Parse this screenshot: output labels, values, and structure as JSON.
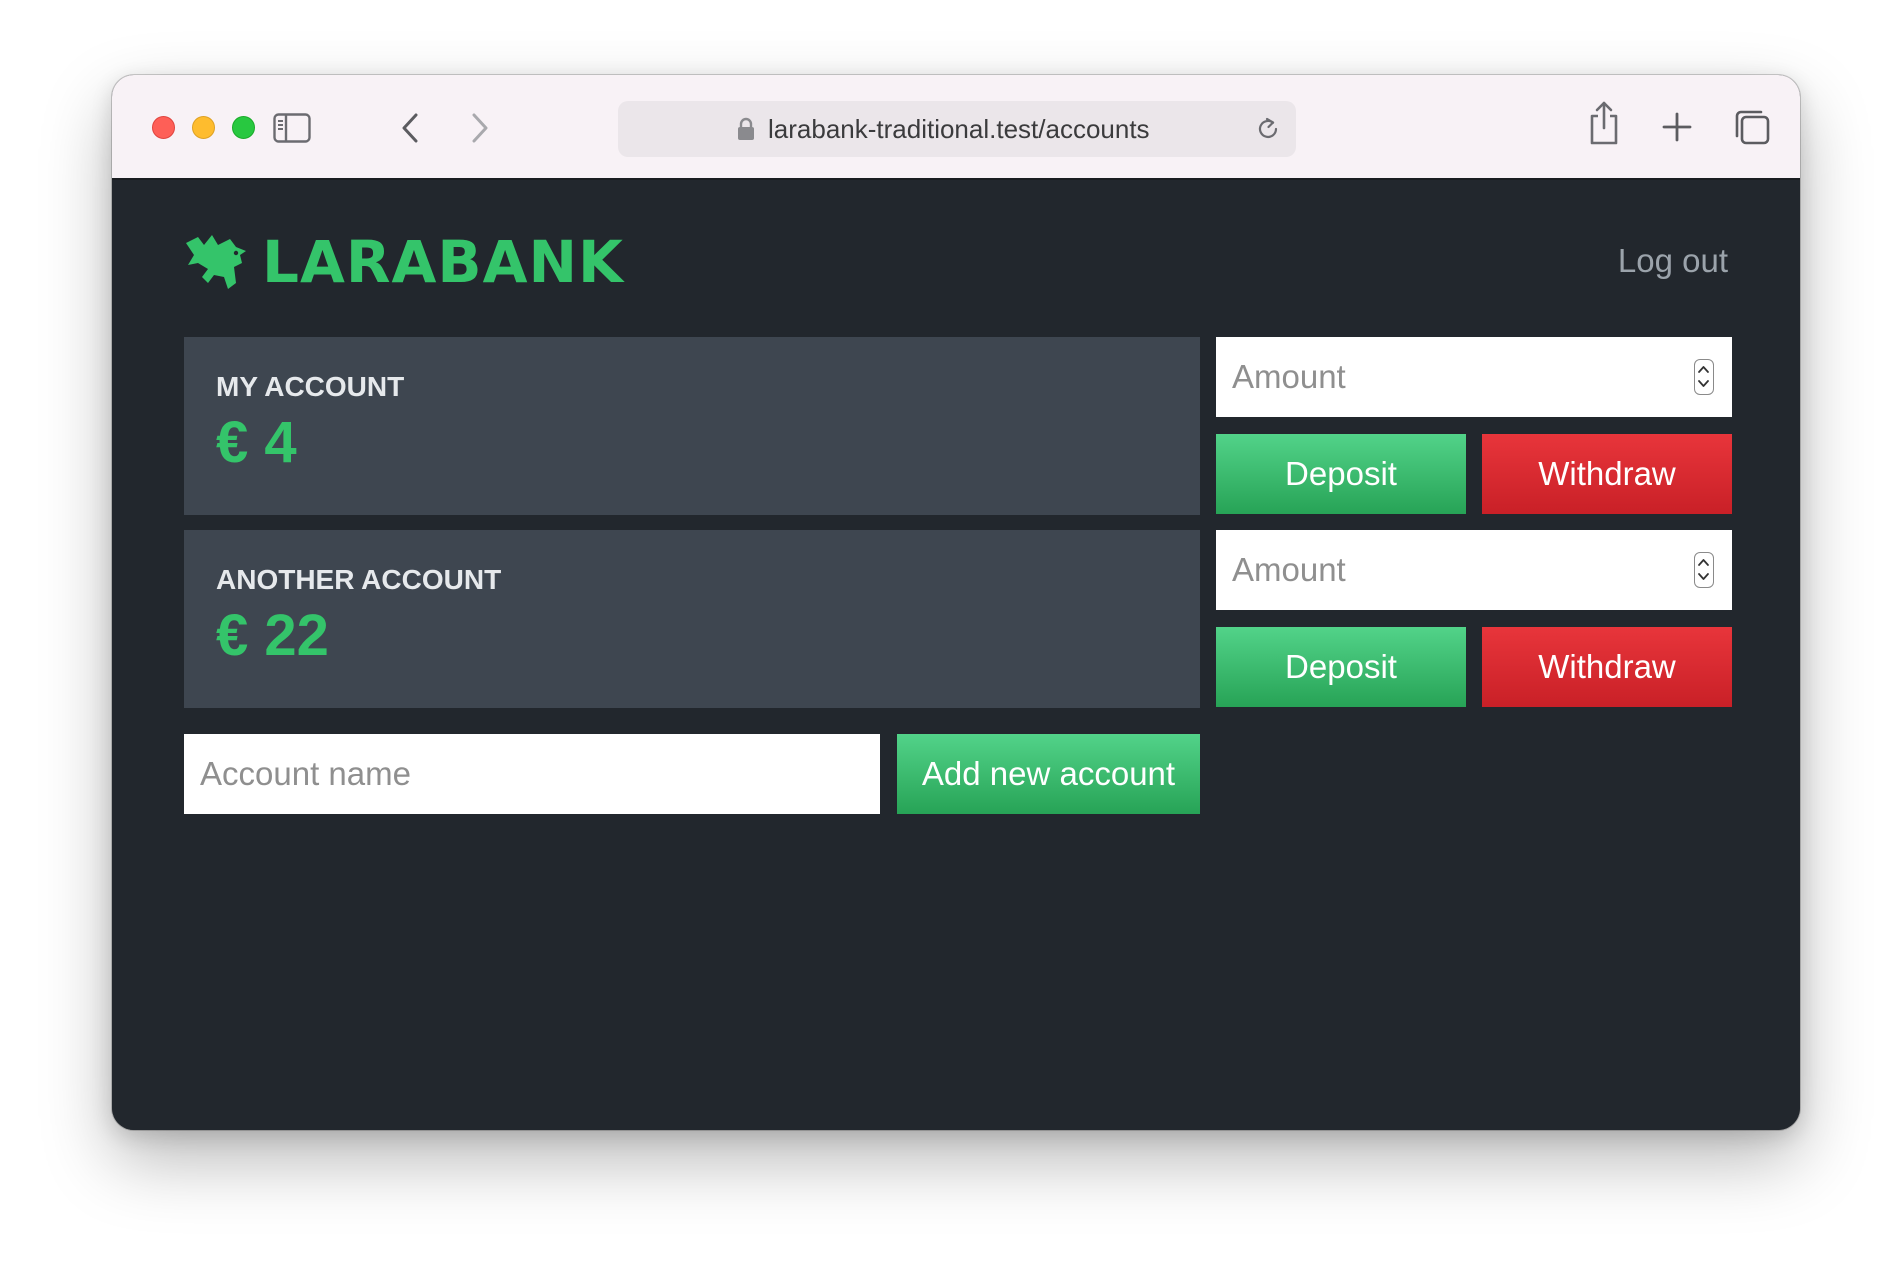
{
  "browser": {
    "url": "larabank-traditional.test/accounts",
    "icons": [
      "sidebar-icon",
      "back-icon",
      "forward-icon",
      "lock-icon",
      "reload-icon",
      "share-icon",
      "new-tab-icon",
      "tabs-overview-icon"
    ]
  },
  "header": {
    "logo_text": "LARABANK",
    "logo_icon": "bird-icon",
    "logout_label": "Log out"
  },
  "accounts": [
    {
      "name": "MY ACCOUNT",
      "balance": "€ 4",
      "amount_placeholder": "Amount",
      "deposit_label": "Deposit",
      "withdraw_label": "Withdraw"
    },
    {
      "name": "ANOTHER ACCOUNT",
      "balance": "€ 22",
      "amount_placeholder": "Amount",
      "deposit_label": "Deposit",
      "withdraw_label": "Withdraw"
    }
  ],
  "new_account": {
    "name_placeholder": "Account name",
    "add_label": "Add new account"
  },
  "colors": {
    "page_bg": "#22272d",
    "card_bg": "#3e4650",
    "accent_green": "#34c46a",
    "danger_red": "#d8292f",
    "muted_text": "#9ba3ab"
  }
}
